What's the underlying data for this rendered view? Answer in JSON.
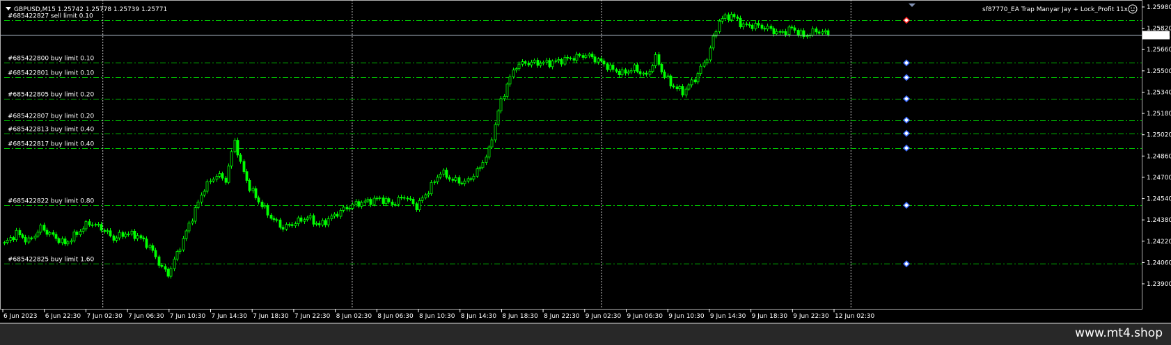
{
  "chart_header": {
    "symbol_line": "GBPUSD,M15  1.25742 1.25778 1.25739 1.25771",
    "ea_label": "sf87770_EA Trap Manyar Jay + Lock_Profit 11x"
  },
  "footer": {
    "text": "www.mt4.shop"
  },
  "current_price": "1.25771",
  "colors": {
    "background": "#000000",
    "candles": "#00ff00",
    "order_lines": "#00c000",
    "price_line": "#b8c4d4",
    "period_separator": "#c8c8c8",
    "sell_marker": "#ff2020",
    "buy_marker": "#3b6cff",
    "footer_bg": "#282828"
  },
  "price_axis": {
    "labels": [
      "1.25980",
      "1.25820",
      "1.25660",
      "1.25500",
      "1.25340",
      "1.25180",
      "1.25020",
      "1.24860",
      "1.24700",
      "1.24540",
      "1.24380",
      "1.24220",
      "1.24060",
      "1.23900"
    ]
  },
  "time_axis": {
    "labels": [
      "6 Jun 2023",
      "6 Jun 22:30",
      "7 Jun 02:30",
      "7 Jun 06:30",
      "7 Jun 10:30",
      "7 Jun 14:30",
      "7 Jun 18:30",
      "7 Jun 22:30",
      "8 Jun 02:30",
      "8 Jun 06:30",
      "8 Jun 10:30",
      "8 Jun 14:30",
      "8 Jun 18:30",
      "8 Jun 22:30",
      "9 Jun 02:30",
      "9 Jun 06:30",
      "9 Jun 10:30",
      "9 Jun 14:30",
      "9 Jun 18:30",
      "9 Jun 22:30",
      "12 Jun 02:30"
    ]
  },
  "orders": [
    {
      "label": "#685422827 sell limit 0.10",
      "type": "sell",
      "price": 1.2588
    },
    {
      "label": "#685422800 buy limit 0.10",
      "type": "buy",
      "price": 1.2556
    },
    {
      "label": "#685422801 buy limit 0.10",
      "type": "buy",
      "price": 1.2545
    },
    {
      "label": "#685422805 buy limit 0.20",
      "type": "buy",
      "price": 1.2529
    },
    {
      "label": "#685422807 buy limit 0.20",
      "type": "buy",
      "price": 1.2513
    },
    {
      "label": "#685422813 buy limit 0.40",
      "type": "buy",
      "price": 1.2503
    },
    {
      "label": "#685422817 buy limit 0.40",
      "type": "buy",
      "price": 1.2492
    },
    {
      "label": "#685422822 buy limit 0.80",
      "type": "buy",
      "price": 1.2449
    },
    {
      "label": "#685422825 buy limit 1.60",
      "type": "buy",
      "price": 1.2405
    }
  ],
  "chart_data": {
    "type": "candlestick",
    "symbol": "GBPUSD",
    "timeframe": "M15",
    "ylim": [
      1.239,
      1.2598
    ],
    "current_price": 1.25771,
    "last_bar": {
      "open": 1.25742,
      "high": 1.25778,
      "low": 1.25739,
      "close": 1.25771
    },
    "x_ticks": [
      "6 Jun 2023",
      "6 Jun 22:30",
      "7 Jun 02:30",
      "7 Jun 06:30",
      "7 Jun 10:30",
      "7 Jun 14:30",
      "7 Jun 18:30",
      "7 Jun 22:30",
      "8 Jun 02:30",
      "8 Jun 06:30",
      "8 Jun 10:30",
      "8 Jun 14:30",
      "8 Jun 18:30",
      "8 Jun 22:30",
      "9 Jun 02:30",
      "9 Jun 06:30",
      "9 Jun 10:30",
      "9 Jun 14:30",
      "9 Jun 18:30",
      "9 Jun 22:30",
      "12 Jun 02:30"
    ],
    "y_ticks": [
      1.2598,
      1.2582,
      1.2566,
      1.255,
      1.2534,
      1.2518,
      1.2502,
      1.2486,
      1.247,
      1.2454,
      1.2438,
      1.2422,
      1.2406,
      1.239
    ],
    "period_separators": [
      "6 Jun 22:30",
      "7 Jun 22:30",
      "8 Jun 22:30",
      "9 Jun 22:30"
    ],
    "close_path": [
      [
        0,
        1.242
      ],
      [
        4,
        1.2428
      ],
      [
        8,
        1.2422
      ],
      [
        12,
        1.2432
      ],
      [
        16,
        1.2426
      ],
      [
        20,
        1.242
      ],
      [
        24,
        1.2428
      ],
      [
        28,
        1.2436
      ],
      [
        32,
        1.2432
      ],
      [
        36,
        1.2424
      ],
      [
        40,
        1.2428
      ],
      [
        44,
        1.2426
      ],
      [
        48,
        1.2418
      ],
      [
        52,
        1.2402
      ],
      [
        54,
        1.2397
      ],
      [
        58,
        1.2418
      ],
      [
        62,
        1.244
      ],
      [
        66,
        1.2462
      ],
      [
        70,
        1.2472
      ],
      [
        73,
        1.2468
      ],
      [
        76,
        1.2498
      ],
      [
        78,
        1.248
      ],
      [
        81,
        1.2462
      ],
      [
        84,
        1.2452
      ],
      [
        88,
        1.244
      ],
      [
        92,
        1.2432
      ],
      [
        96,
        1.2436
      ],
      [
        100,
        1.244
      ],
      [
        104,
        1.2434
      ],
      [
        108,
        1.244
      ],
      [
        112,
        1.2446
      ],
      [
        116,
        1.245
      ],
      [
        120,
        1.2452
      ],
      [
        124,
        1.2454
      ],
      [
        128,
        1.245
      ],
      [
        132,
        1.2456
      ],
      [
        136,
        1.2448
      ],
      [
        140,
        1.246
      ],
      [
        144,
        1.2474
      ],
      [
        148,
        1.2468
      ],
      [
        152,
        1.2466
      ],
      [
        156,
        1.2474
      ],
      [
        160,
        1.249
      ],
      [
        163,
        1.252
      ],
      [
        166,
        1.254
      ],
      [
        169,
        1.2554
      ],
      [
        172,
        1.2556
      ],
      [
        176,
        1.2556
      ],
      [
        180,
        1.2556
      ],
      [
        184,
        1.2558
      ],
      [
        188,
        1.256
      ],
      [
        192,
        1.2562
      ],
      [
        196,
        1.2558
      ],
      [
        200,
        1.2552
      ],
      [
        204,
        1.2548
      ],
      [
        208,
        1.2552
      ],
      [
        212,
        1.2546
      ],
      [
        215,
        1.256
      ],
      [
        217,
        1.255
      ],
      [
        220,
        1.254
      ],
      [
        224,
        1.2534
      ],
      [
        228,
        1.2544
      ],
      [
        232,
        1.256
      ],
      [
        236,
        1.2588
      ],
      [
        240,
        1.2592
      ],
      [
        244,
        1.2584
      ],
      [
        248,
        1.2584
      ],
      [
        252,
        1.2582
      ],
      [
        256,
        1.2578
      ],
      [
        260,
        1.2582
      ],
      [
        264,
        1.2576
      ],
      [
        268,
        1.258
      ],
      [
        272,
        1.2578
      ]
    ]
  }
}
